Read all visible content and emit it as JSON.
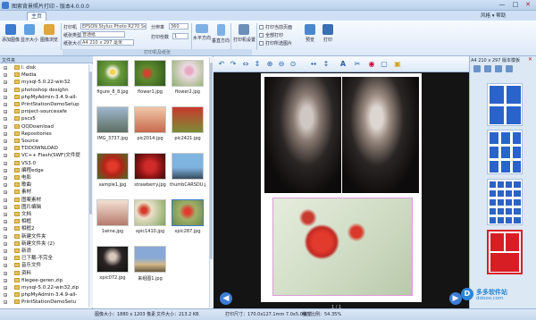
{
  "window": {
    "title": "图索背景照片打印 - 版本4.0.0.0",
    "minimize": "—",
    "maximize": "□",
    "close": "✕",
    "toplinks": "风格 ▾ 帮助"
  },
  "tabs": [
    {
      "label": "主页"
    }
  ],
  "ribbon": {
    "add_image": "添加图像",
    "show_size": "显示大小",
    "photo_browse": "图像浏览",
    "printer_label": "打印机",
    "printer_value": "EPSON Stylus Photo R270 Series",
    "paper_type_label": "纸张类型",
    "paper_type_value": "普通纸",
    "paper_size_label": "纸张大小",
    "paper_size_value": "A4 210 x 297 毫米",
    "dpi_label": "分辨率",
    "dpi_value": "360",
    "copies_label": "打印份数",
    "copies_value": "1",
    "landscape": "水平方向",
    "portrait": "垂直方向",
    "printer_settings": "打印机设置",
    "print_options": [
      "打印当前页面",
      "全部打印",
      "打印所选图片"
    ],
    "preview": "预览",
    "print": "打印",
    "group_label": "打印机及纸张"
  },
  "tree": {
    "header": "文件夹",
    "items": [
      {
        "label": "l: disk"
      },
      {
        "label": "Media"
      },
      {
        "label": "mysql-5.0.22-win32"
      },
      {
        "label": "photoshop desighn"
      },
      {
        "label": "phpMyAdmin-3.4.9-all-"
      },
      {
        "label": "PrintStationDemoSetup"
      },
      {
        "label": "project-sourcesafe"
      },
      {
        "label": "pscs5"
      },
      {
        "label": "QQDownload"
      },
      {
        "label": "Repositories"
      },
      {
        "label": "Source"
      },
      {
        "label": "TDDOWNLOAD"
      },
      {
        "label": "VC++ Flash(SWF)文件提"
      },
      {
        "label": "VS3.0"
      },
      {
        "label": "编程edge"
      },
      {
        "label": "电影"
      },
      {
        "label": "歌曲"
      },
      {
        "label": "素材"
      },
      {
        "label": "图案素材"
      },
      {
        "label": "图片编辑"
      },
      {
        "label": "文档"
      },
      {
        "label": "相框"
      },
      {
        "label": "相框2"
      },
      {
        "label": "新建文件夹"
      },
      {
        "label": "新建文件夹 (2)"
      },
      {
        "label": "新浪"
      },
      {
        "label": "已下载-不完全"
      },
      {
        "label": "音乐文件"
      },
      {
        "label": "资料"
      },
      {
        "label": "filegee-geren.zip"
      },
      {
        "label": "mysql-5.0.22-win32.zip"
      },
      {
        "label": "phpMyAdmin-3.4.9-all-"
      },
      {
        "label": "PrintStationDemoSetu"
      }
    ]
  },
  "thumbnails": [
    {
      "label": "figure_8_8.jpg"
    },
    {
      "label": "flower1.jpg"
    },
    {
      "label": "flower2.jpg"
    },
    {
      "label": "IMG_3737.jpg"
    },
    {
      "label": "pic2014.jpg"
    },
    {
      "label": "pic2421.jpg"
    },
    {
      "label": "sample1.jpg"
    },
    {
      "label": "strawberry.jpg"
    },
    {
      "label": "thumbCARSDU.jpg"
    },
    {
      "label": "1wine.jpg"
    },
    {
      "label": "xpic1410.jpg"
    },
    {
      "label": "xpic287.jpg"
    },
    {
      "label": "xpic072.jpg"
    },
    {
      "label": "来组图1.jpg"
    }
  ],
  "canvas": {
    "page_indicator": "1 / 1"
  },
  "right_panel": {
    "header": "A4 210 x 297 版本模板"
  },
  "status": {
    "image_size": "图像大小：1880 x 1203 像素",
    "file_size": "文件大小：213.2 KB",
    "print_size": "打印尺寸：170.0x127.1mm 7.0x5.0英寸",
    "zoom": "缩放比例：54.35%"
  },
  "watermark": {
    "logo": "D",
    "name": "多多软件站",
    "url": "ddooo.com"
  }
}
